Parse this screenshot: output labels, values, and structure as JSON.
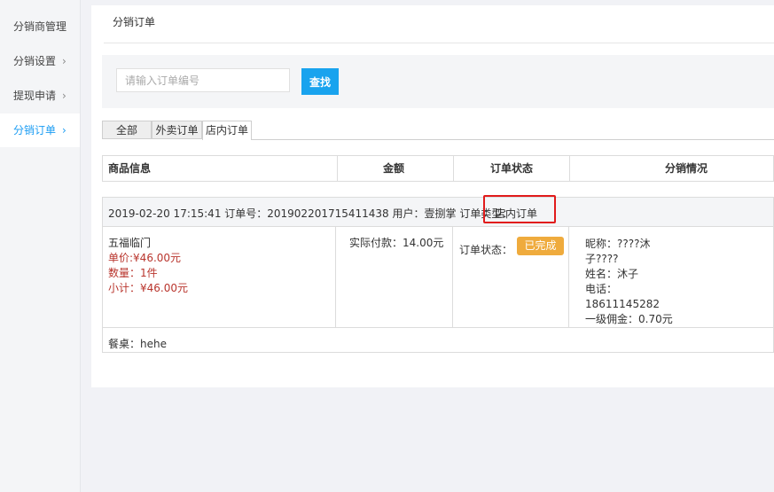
{
  "sidebar": {
    "items": [
      {
        "label": "分销商管理",
        "chevron": ""
      },
      {
        "label": "分销设置",
        "chevron": "›"
      },
      {
        "label": "提现申请",
        "chevron": "›"
      },
      {
        "label": "分销订单",
        "chevron": "›"
      }
    ],
    "active_index": 3
  },
  "page": {
    "title": "分销订单"
  },
  "search": {
    "placeholder": "请输入订单编号",
    "value": "",
    "button_label": "查找"
  },
  "tabs": [
    {
      "label": "全部"
    },
    {
      "label": "外卖订单"
    },
    {
      "label": "店内订单",
      "active": true
    }
  ],
  "table": {
    "headers": [
      "商品信息",
      "金额",
      "订单状态",
      "分销情况"
    ]
  },
  "order": {
    "header_text": "2019-02-20 17:15:41 订单号：201902201715411438 用户：壹捌掌 订单类型：",
    "order_type": "店内订单",
    "product": {
      "name": "五福临门",
      "unit_price": "单价:¥46.00元",
      "quantity": "数量：1件",
      "subtotal": "小计：¥46.00元"
    },
    "amount": "实际付款：14.00元",
    "status_label": "订单状态：",
    "status_badge": "已完成",
    "distribution": {
      "nickname_line1": "昵称：????沐",
      "nickname_line2": "子????",
      "name": "姓名：沐子",
      "phone_label": "电话：",
      "phone": "18611145282",
      "commission": "一级佣金：0.70元"
    },
    "table_no": "餐桌：hehe"
  },
  "colors": {
    "accent": "#1a9cf3",
    "button": "#19a3ee",
    "badge": "#efab3d",
    "price": "#b9352d",
    "highlight": "#e11b1b"
  }
}
